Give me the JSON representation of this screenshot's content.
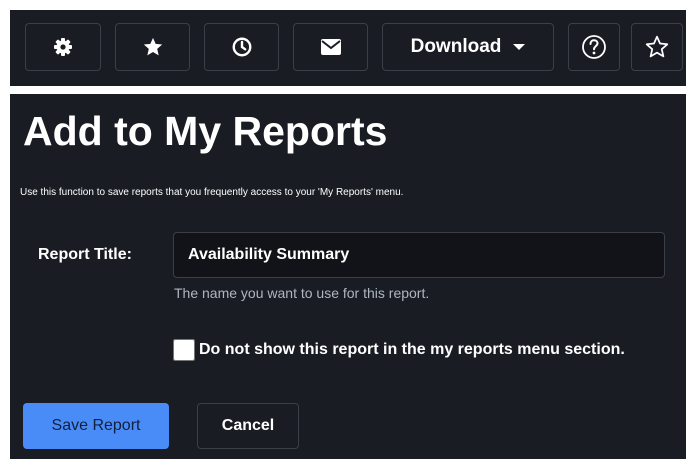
{
  "toolbar": {
    "icons": [
      "gear-icon",
      "star-icon",
      "clock-icon",
      "envelope-icon",
      "help-circle-icon",
      "star-outline-icon"
    ],
    "download_label": "Download"
  },
  "page": {
    "title": "Add to My Reports",
    "description": "Use this function to save reports that you frequently access to your 'My Reports' menu."
  },
  "form": {
    "report_title_label": "Report Title:",
    "report_title_value": "Availability Summary",
    "report_title_hint": "The name you want to use for this report.",
    "hide_checkbox_label": "Do not show this report in the my reports menu section.",
    "hide_checkbox_checked": false
  },
  "actions": {
    "save_label": "Save Report",
    "cancel_label": "Cancel"
  },
  "colors": {
    "background": "#191c22",
    "primary_button": "#4a8cf7",
    "hint_text": "#aeb6c0",
    "border": "#3b3f47"
  }
}
